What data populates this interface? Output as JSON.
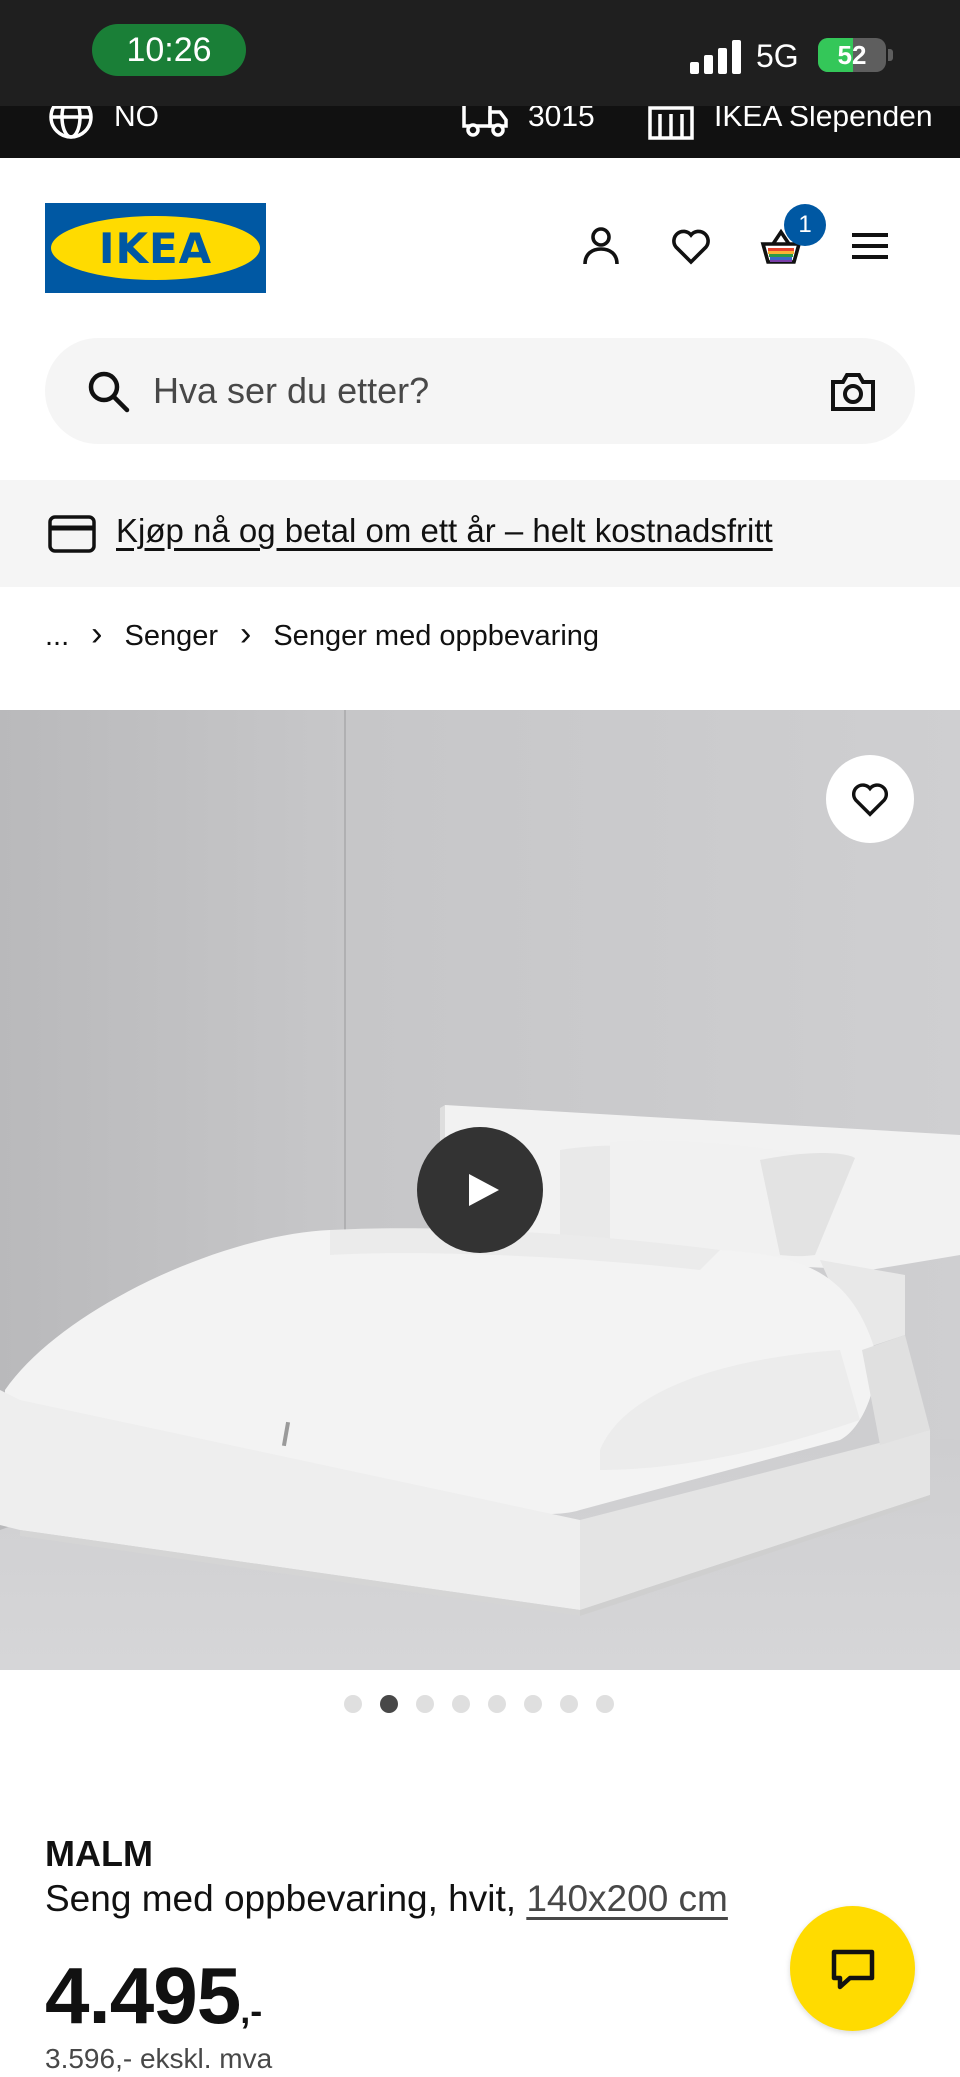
{
  "status_bar": {
    "time": "10:26",
    "network": "5G",
    "battery": "52",
    "battery_level": 0.52
  },
  "utility_bar": {
    "language": "NO",
    "postcode": "3015",
    "store": "IKEA Slependen"
  },
  "header": {
    "logo_text": "IKEA",
    "cart_count": "1"
  },
  "search": {
    "placeholder": "Hva ser du etter?"
  },
  "promo": {
    "text": "Kjøp nå og betal om ett år – helt kostnadsfritt"
  },
  "breadcrumb": {
    "ellipsis": "...",
    "items": [
      "Senger",
      "Senger med oppbevaring"
    ]
  },
  "carousel": {
    "total": 8,
    "active_index": 1
  },
  "product": {
    "name": "MALM",
    "description": "Seng med oppbevaring, hvit, ",
    "size": "140x200 cm",
    "price": "4.495",
    "price_suffix": ",-",
    "price_ex_vat": "3.596,- ekskl. mva"
  },
  "colors": {
    "brand_blue": "#0058a3",
    "brand_yellow": "#ffdb00",
    "status_green": "#1a7f37"
  },
  "icons": {
    "language": "globe-icon",
    "delivery": "truck-icon",
    "store": "store-icon",
    "account": "person-icon",
    "favourites": "heart-icon",
    "cart": "basket-icon",
    "menu": "hamburger-menu-icon",
    "search": "search-icon",
    "visual_search": "camera-icon",
    "payment": "credit-card-icon",
    "video": "play-icon",
    "chat": "chat-bubble-icon"
  }
}
